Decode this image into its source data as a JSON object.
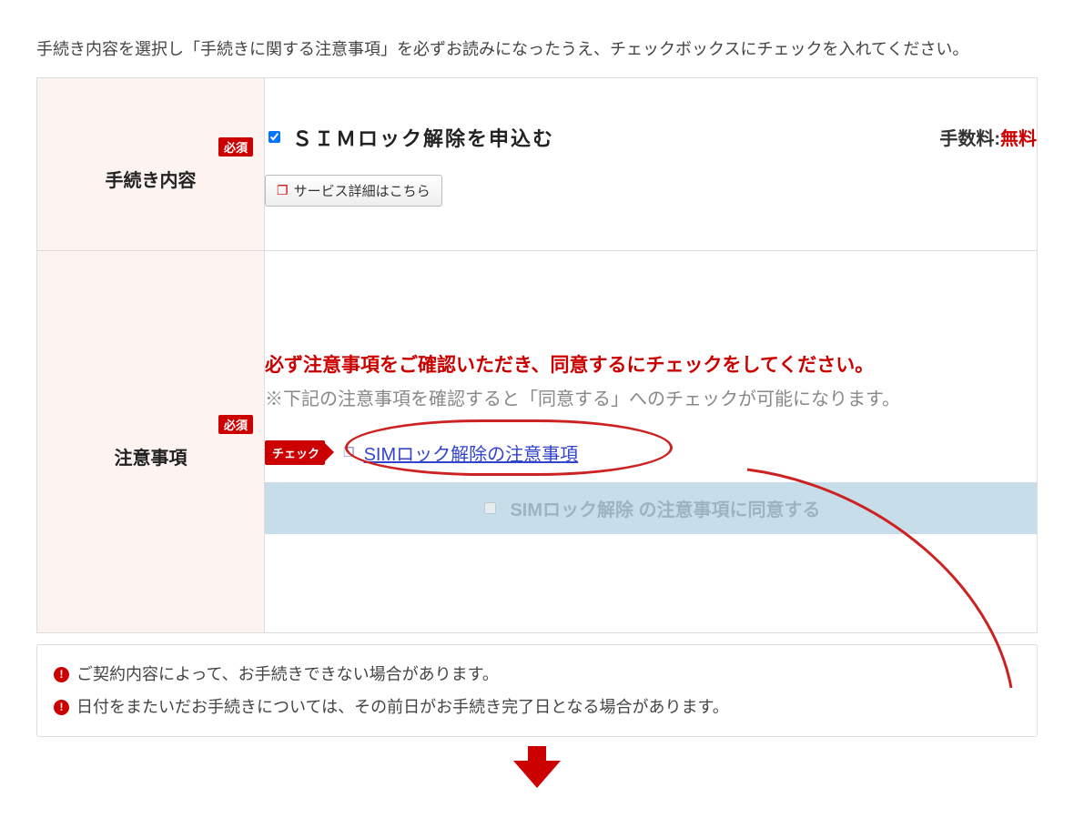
{
  "intro": "手続き内容を選択し「手続きに関する注意事項」を必ずお読みになったうえ、チェックボックスにチェックを入れてください。",
  "badges": {
    "required": "必須",
    "check": "チェック"
  },
  "row1": {
    "label": "手続き内容",
    "checkbox_label": "ＳＩＭロック解除を申込む",
    "fee_label": "手数料:",
    "fee_value": "無料",
    "detail_button": "サービス詳細はこちら"
  },
  "row2": {
    "label": "注意事項",
    "warn": "必ず注意事項をご確認いただき、同意するにチェックをしてください。",
    "note": "※下記の注意事項を確認すると「同意する」へのチェックが可能になります。",
    "terms_link": "SIMロック解除の注意事項",
    "agree_label": "SIMロック解除 の注意事項に同意する"
  },
  "footer_notes": [
    "ご契約内容によって、お手続きできない場合があります。",
    "日付をまたいだお手続きについては、その前日がお手続き完了日となる場合があります。"
  ]
}
